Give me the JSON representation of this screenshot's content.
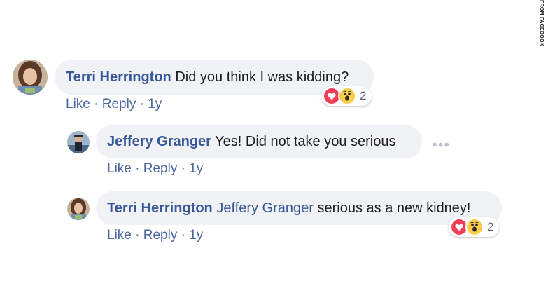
{
  "source_credit": "FROM FACEBOOK",
  "comments": [
    {
      "author": "Terri Herrington",
      "text": "Did you think I was kidding?",
      "actions": {
        "like": "Like",
        "reply": "Reply",
        "separator": "·",
        "time": "1y"
      },
      "reactions": {
        "icons": [
          "love-icon",
          "wow-icon"
        ],
        "count": "2"
      }
    },
    {
      "author": "Jeffery Granger",
      "text": "Yes! Did not take you serious",
      "actions": {
        "like": "Like",
        "reply": "Reply",
        "separator": "·",
        "time": "1y"
      },
      "more_icon": "ellipsis-icon",
      "more_glyph": "•••"
    },
    {
      "author": "Terri Herrington",
      "mention": "Jeffery Granger",
      "text": "serious as a new kidney!",
      "actions": {
        "like": "Like",
        "reply": "Reply",
        "separator": "·",
        "time": "1y"
      },
      "reactions": {
        "icons": [
          "love-icon",
          "wow-icon"
        ],
        "count": "2"
      }
    }
  ],
  "colors": {
    "author": "#385898",
    "bubble": "#f0f2f5",
    "love": "#f33e58",
    "wow": "#fbcd4a"
  }
}
